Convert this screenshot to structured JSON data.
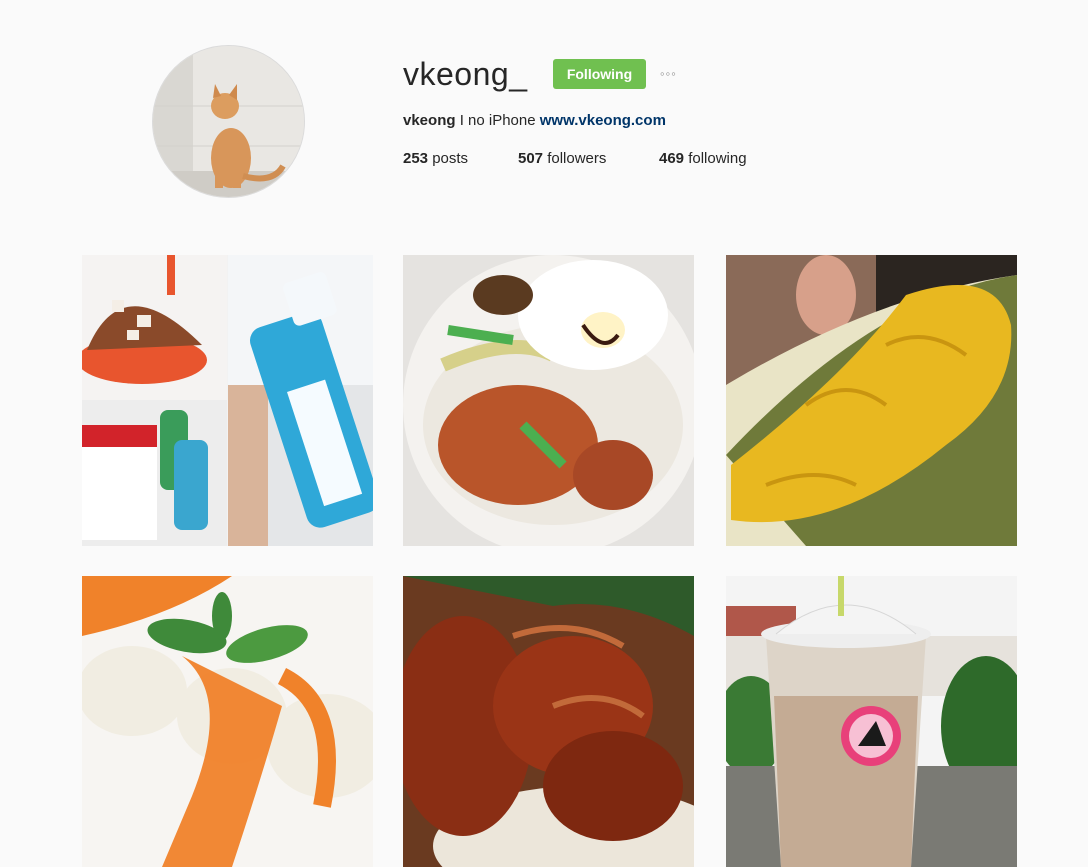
{
  "profile": {
    "username": "vkeong_",
    "follow_label": "Following",
    "more_label": "◦◦◦",
    "bio_name": "vkeong",
    "bio_text": "I no iPhone",
    "website": "www.vkeong.com",
    "posts_count": "253",
    "posts_label": "posts",
    "followers_count": "507",
    "followers_label": "followers",
    "following_count": "469",
    "following_label": "following"
  },
  "colors": {
    "follow_button": "#70c050",
    "link": "#003569",
    "background": "#fafafa"
  },
  "posts": [
    {
      "subject": "shaved-ice-and-mouthwash-collage"
    },
    {
      "subject": "rice-with-fried-egg"
    },
    {
      "subject": "durian"
    },
    {
      "subject": "coconut-rolls-with-sauce"
    },
    {
      "subject": "roast-chicken-rice"
    },
    {
      "subject": "iced-drink-cup"
    }
  ]
}
